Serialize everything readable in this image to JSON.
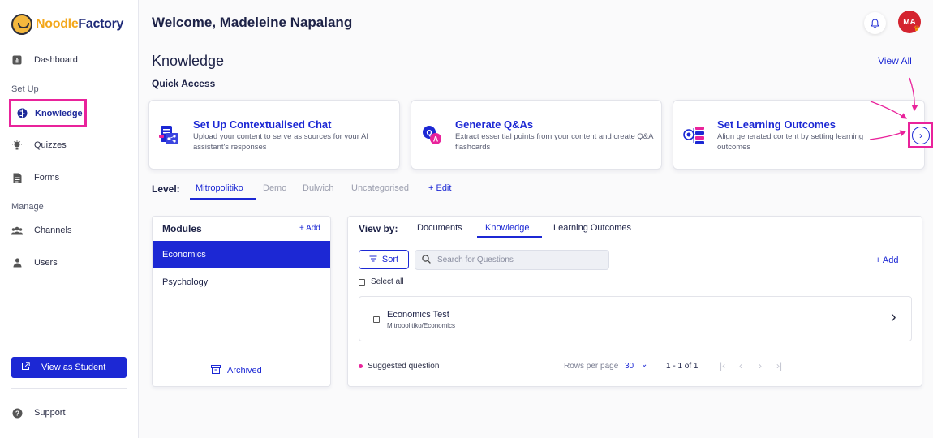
{
  "brand": {
    "part1": "Noodle",
    "part2": "Factory"
  },
  "sidebar": {
    "dashboard": "Dashboard",
    "setup_section": "Set Up",
    "knowledge": "Knowledge",
    "quizzes": "Quizzes",
    "forms": "Forms",
    "manage_section": "Manage",
    "channels": "Channels",
    "users": "Users",
    "view_as_student": "View as Student",
    "support": "Support"
  },
  "header": {
    "welcome": "Welcome, Madeleine Napalang",
    "avatar_initials": "MA"
  },
  "page": {
    "title": "Knowledge",
    "view_all": "View All",
    "quick_access": "Quick Access"
  },
  "quick_access_cards": [
    {
      "title": "Set Up Contextualised Chat",
      "desc": "Upload your content to serve as sources for your AI assistant's responses",
      "icon": "chat-document-icon"
    },
    {
      "title": "Generate Q&As",
      "desc": "Extract essential points from your content and create Q&A flashcards",
      "icon": "qa-bubbles-icon"
    },
    {
      "title": "Set Learning Outcomes",
      "desc": "Align generated content by setting learning outcomes",
      "icon": "target-list-icon"
    }
  ],
  "level": {
    "label": "Level:",
    "tabs": [
      "Mitropolitiko",
      "Demo",
      "Dulwich",
      "Uncategorised"
    ],
    "edit": "+ Edit"
  },
  "modules": {
    "title": "Modules",
    "add": "+ Add",
    "items": [
      "Economics",
      "Psychology"
    ],
    "archived": "Archived"
  },
  "main": {
    "view_by": "View by:",
    "tabs": [
      "Documents",
      "Knowledge",
      "Learning Outcomes"
    ],
    "sort": "Sort",
    "search_placeholder": "Search for Questions",
    "add": "+ Add",
    "select_all": "Select all",
    "rows": [
      {
        "title": "Economics Test",
        "path": "Mitropolitiko/Economics"
      }
    ],
    "suggested": "Suggested question",
    "rows_per_page_label": "Rows per page",
    "rows_per_page_value": "30",
    "range": "1 - 1 of 1"
  },
  "colors": {
    "accent": "#1c28d4",
    "highlight": "#e9239b",
    "brand_orange": "#f3a71b",
    "avatar": "#d4232f"
  }
}
